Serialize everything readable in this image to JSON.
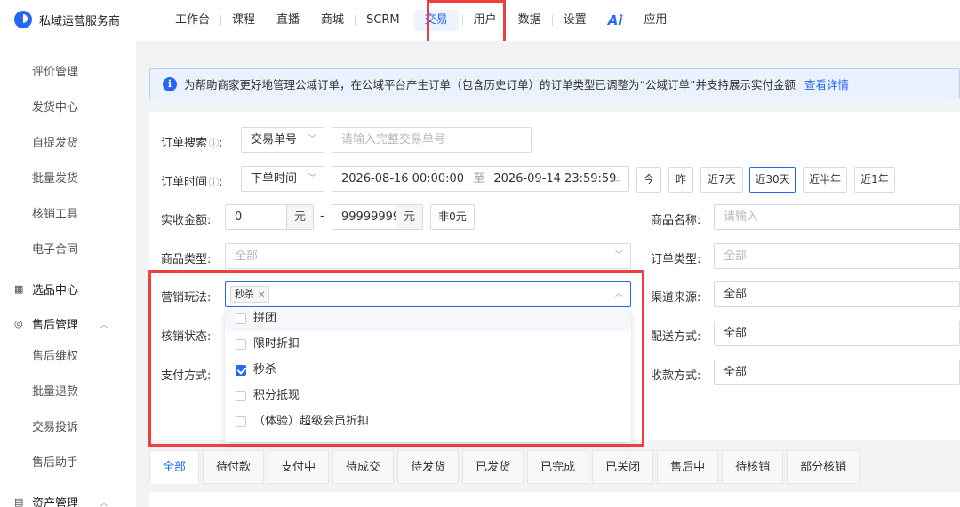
{
  "app": {
    "brand": "私域运营服务商"
  },
  "nav": {
    "items": [
      "工作台",
      "课程",
      "直播",
      "商城",
      "SCRM",
      "交易",
      "用户",
      "数据",
      "设置"
    ],
    "ai": "Ai",
    "apps": "应用",
    "active": "交易"
  },
  "sidebar": {
    "items_top": [
      "评价管理",
      "发货中心",
      "自提发货",
      "批量发货",
      "核销工具",
      "电子合同"
    ],
    "group_select": "选品中心",
    "group_aftersale": "售后管理",
    "items_aftersale": [
      "售后维权",
      "批量退款",
      "交易投诉",
      "售后助手"
    ],
    "group_assets": "资产管理"
  },
  "notice": {
    "text": "为帮助商家更好地管理公域订单，在公域平台产生订单（包含历史订单）的订单类型已调整为“公域订单”并支持展示实付金额",
    "link": "查看详情"
  },
  "form": {
    "order_search_label": "订单搜索",
    "order_search_type": "交易单号",
    "order_search_placeholder": "请输入完整交易单号",
    "order_time_label": "订单时间",
    "order_time_type": "下单时间",
    "date_start": "2026-08-16 00:00:00",
    "date_sep": "至",
    "date_end": "2026-09-14 23:59:59",
    "quick_ranges": [
      "今",
      "昨",
      "近7天",
      "近30天",
      "近半年",
      "近1年"
    ],
    "quick_active": "近30天",
    "amount_label": "实收金额:",
    "amount_min": "0",
    "amount_max": "99999999",
    "amount_unit": "元",
    "amount_dash": "-",
    "nonzero_btn": "非0元",
    "product_name_label": "商品名称:",
    "product_name_placeholder": "请输入",
    "product_type_label": "商品类型:",
    "product_type_value": "全部",
    "order_type_label": "订单类型:",
    "order_type_value": "全部",
    "marketing_label": "营销玩法:",
    "marketing_tag": "秒杀",
    "channel_label": "渠道来源:",
    "channel_value": "全部",
    "verify_label": "核销状态:",
    "delivery_label": "配送方式:",
    "delivery_value": "全部",
    "payment_label": "支付方式:",
    "collect_label": "收款方式:",
    "collect_value": "全部"
  },
  "dropdown": {
    "options": [
      {
        "label": "拼团",
        "checked": false
      },
      {
        "label": "限时折扣",
        "checked": false
      },
      {
        "label": "秒杀",
        "checked": true
      },
      {
        "label": "积分抵现",
        "checked": false
      },
      {
        "label": "（体验）超级会员折扣",
        "checked": false
      }
    ]
  },
  "tabs": {
    "items": [
      "全部",
      "待付款",
      "支付中",
      "待成交",
      "待发货",
      "已发货",
      "已完成",
      "已关闭",
      "售后中",
      "待核销",
      "部分核销"
    ],
    "active": "全部"
  },
  "colors": {
    "accent": "#2468f2",
    "highlight": "#ef3e3e",
    "notice_bg": "#eaf1ff"
  }
}
